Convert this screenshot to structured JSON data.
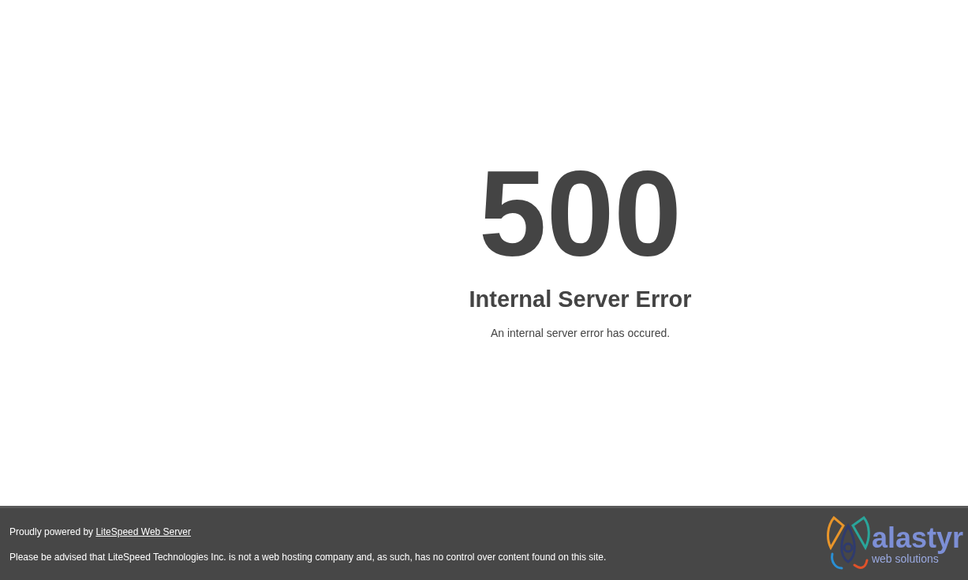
{
  "error": {
    "code": "500",
    "title": "Internal Server Error",
    "message": "An internal server error has occured."
  },
  "footer": {
    "powered_by": "Proudly powered by",
    "link": "LiteSpeed Web Server",
    "notice": "Please be advised that LiteSpeed Technologies Inc. is not a web hosting company and, as such, has no control over content found on this site.",
    "logo": {
      "name": "alastyr",
      "tagline": "web solutions"
    }
  }
}
